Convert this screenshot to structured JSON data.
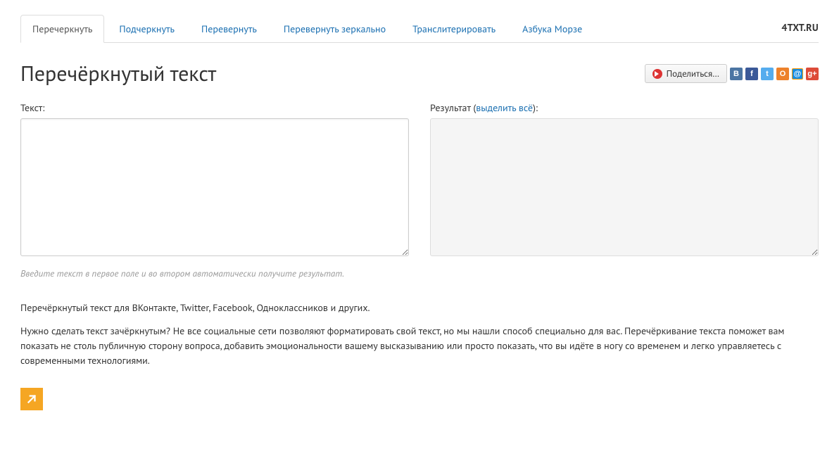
{
  "brand": "4TXT.RU",
  "tabs": [
    {
      "label": "Перечеркнуть",
      "active": true
    },
    {
      "label": "Подчеркнуть",
      "active": false
    },
    {
      "label": "Перевернуть",
      "active": false
    },
    {
      "label": "Перевернуть зеркально",
      "active": false
    },
    {
      "label": "Транслитерировать",
      "active": false
    },
    {
      "label": "Азбука Морзе",
      "active": false
    }
  ],
  "title": "Перечёркнутый текст",
  "share": {
    "button": "Поделиться…",
    "networks": {
      "vk": "B",
      "fb": "f",
      "tw": "t",
      "ok": "O",
      "mr": "@",
      "gp": "g+"
    }
  },
  "input": {
    "label": "Текст:",
    "value": ""
  },
  "output": {
    "label_prefix": "Результат (",
    "select_all": "выделить всё",
    "label_suffix": "):",
    "value": ""
  },
  "hint": "Введите текст в первое поле и во втором автоматически получите результат.",
  "description": {
    "p1": "Перечёркнутый текст для ВКонтакте, Twitter, Facebook, Одноклассников и других.",
    "p2": "Нужно сделать текст зачёркнутым? Не все социальные сети позволяют форматировать свой текст, но мы нашли способ специально для вас. Перечёркивание текста поможет вам показать не столь публичную сторону вопроса, добавить эмоциональности вашему высказыванию или просто показать, что вы идёте в ногу со временем и легко управляетесь с современными технологиями."
  }
}
